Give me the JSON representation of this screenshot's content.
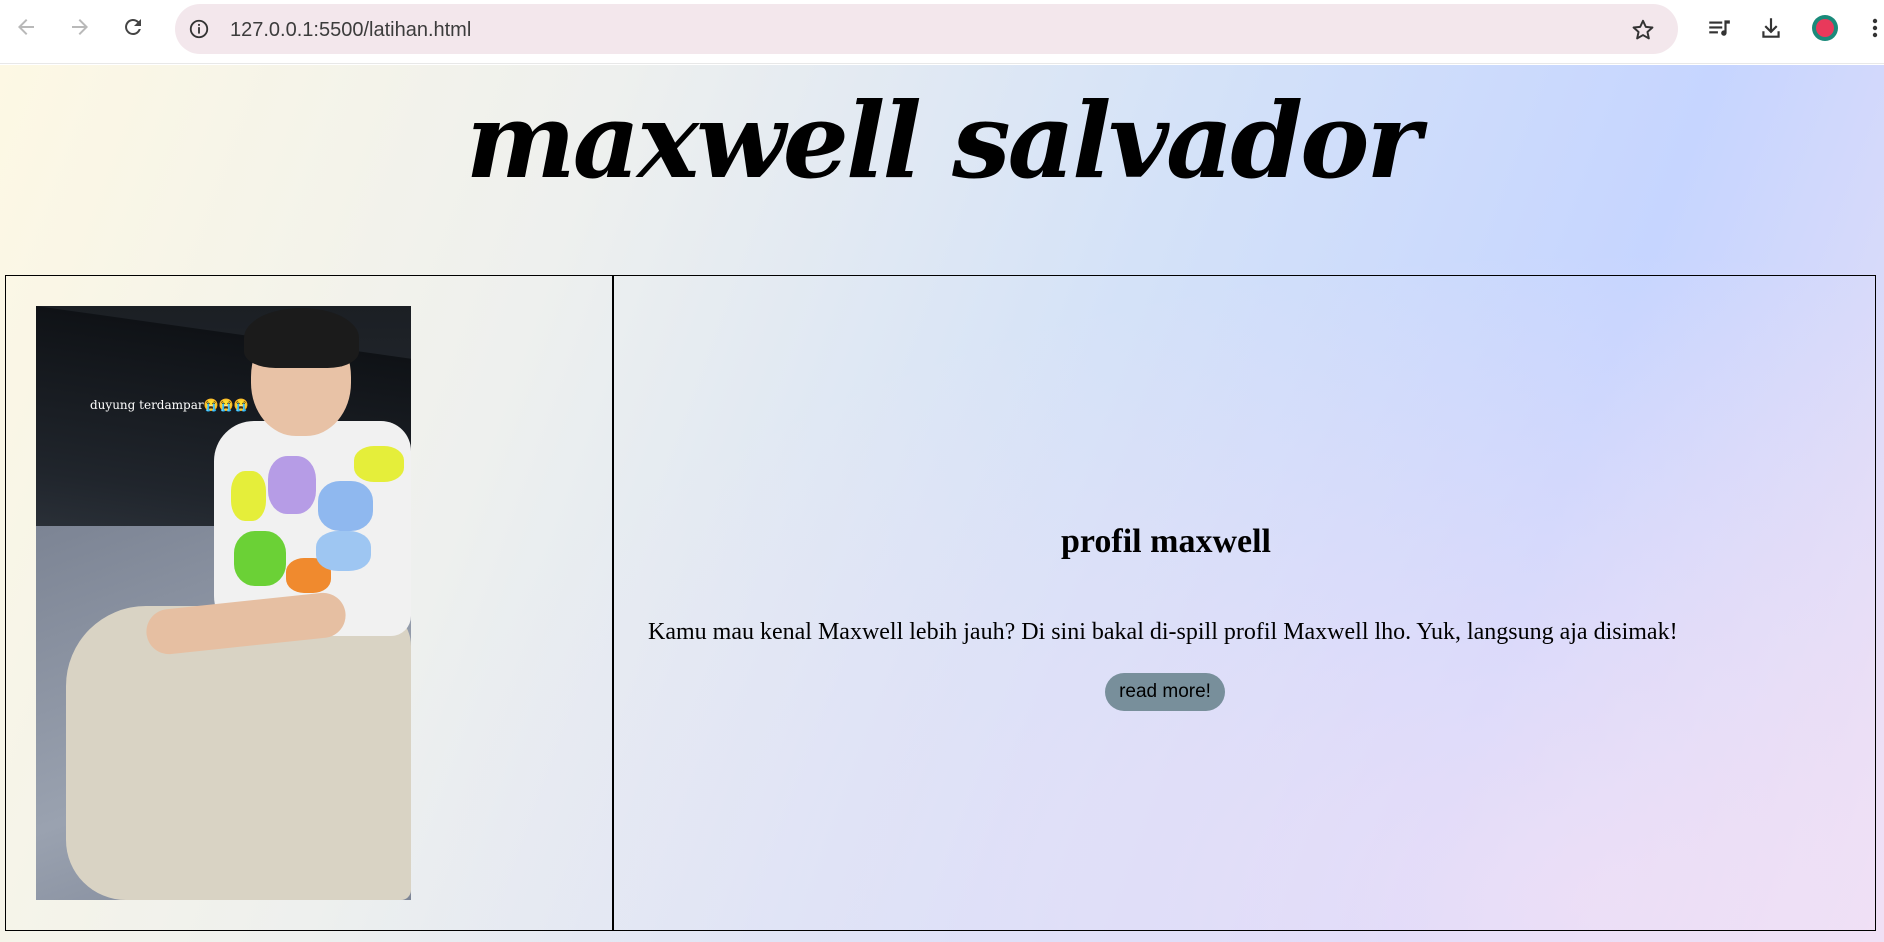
{
  "browser": {
    "url": "127.0.0.1:5500/latihan.html",
    "icons": [
      "back-icon",
      "forward-icon",
      "reload-icon",
      "site-info-icon",
      "bookmark-star-icon",
      "media-controls-icon",
      "download-icon",
      "profile-avatar-icon",
      "more-menu-icon"
    ]
  },
  "page": {
    "site_title": "maxwell salvador",
    "photo_caption": "duyung terdampar😭😭😭",
    "profile": {
      "title": "profil maxwell",
      "description": "Kamu mau kenal Maxwell lebih jauh? Di sini bakal di-spill profil Maxwell lho. Yuk, langsung aja disimak!",
      "button_label": "read more!"
    }
  }
}
